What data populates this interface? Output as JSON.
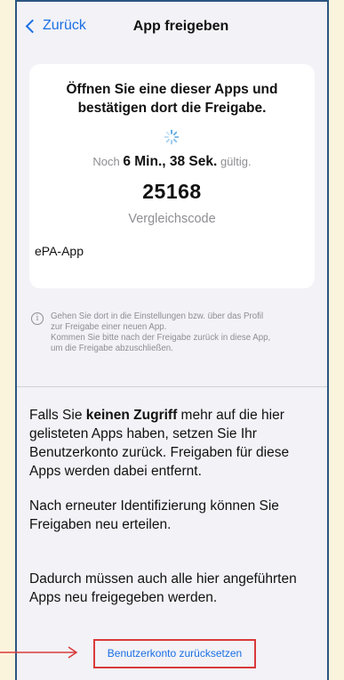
{
  "navbar": {
    "back_label": "Zurück",
    "title": "App freigeben"
  },
  "card": {
    "heading_line1": "Öffnen Sie eine dieser Apps und",
    "heading_line2": "bestätigen dort die Freigabe.",
    "timer_prefix": "Noch",
    "timer_value": "6 Min., 38 Sek.",
    "timer_suffix": "gültig.",
    "code": "25168",
    "code_label": "Vergleichscode",
    "apps": [
      "ePA-App"
    ]
  },
  "info": {
    "lines": [
      "Gehen Sie dort in die Einstellungen bzw. über das Profil",
      "zur Freigabe einer neuen App.",
      "Kommen Sie bitte nach der Freigabe zurück in diese App,",
      "um die Freigabe abzuschließen."
    ]
  },
  "reset_section": {
    "p1_lead": "Falls Sie ",
    "p1_bold": "keinen Zugriff",
    "p1_line1_rest": " mehr auf die hier",
    "p1_lines": [
      "gelisteten Apps haben, setzen Sie Ihr",
      "Benutzerkonto zurück. Freigaben für diese",
      "Apps werden dabei entfernt."
    ],
    "p2_lines": [
      "Nach erneuter Identifizierung können Sie",
      "Freigaben neu erteilen."
    ],
    "p3_lines": [
      "Dadurch müssen auch alle hier angeführten",
      "Apps neu freigegeben werden."
    ],
    "button_label": "Benutzerkonto zurücksetzen"
  },
  "colors": {
    "accent_blue": "#1a6fe3",
    "highlight_red": "#d93a3a",
    "frame_border": "#2b5580",
    "outside_bg": "#fbf4dd"
  }
}
